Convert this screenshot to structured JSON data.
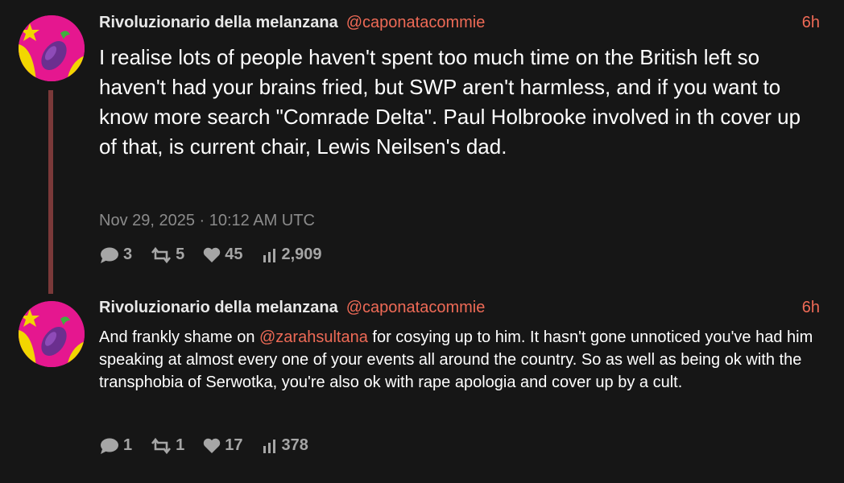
{
  "tweets": [
    {
      "author_name": "Rivoluzionario della melanzana",
      "handle": "@caponatacommie",
      "relative_time": "6h",
      "text": "I realise lots of people haven't spent too much time on the British left so haven't had your brains fried, but SWP aren't harmless, and if you want to know more search \"Comrade Delta\". Paul Holbrooke involved in th cover up of that, is current chair, Lewis Neilsen's dad.",
      "timestamp": "Nov 29, 2025 · 10:12 AM UTC",
      "replies": "3",
      "retweets": "5",
      "likes": "45",
      "views": "2,909",
      "avatar_icon": "eggplant-emoji"
    },
    {
      "author_name": "Rivoluzionario della melanzana",
      "handle": "@caponatacommie",
      "relative_time": "6h",
      "text_before": "And frankly shame on ",
      "mention": "@zarahsultana",
      "text_after": " for cosying up to him. It hasn't gone unnoticed you've had him speaking at almost every one of your events all around the country. So as well as being ok with the transphobia of Serwotka, you're also ok with rape apologia and cover up by a cult.",
      "replies": "1",
      "retweets": "1",
      "likes": "17",
      "views": "378",
      "avatar_icon": "eggplant-emoji"
    }
  ],
  "colors": {
    "background": "#161616",
    "accent": "#ee6a56",
    "thread_line": "#7a3939",
    "avatar_bg": "#e5178f",
    "muted": "#8b8b8b"
  }
}
